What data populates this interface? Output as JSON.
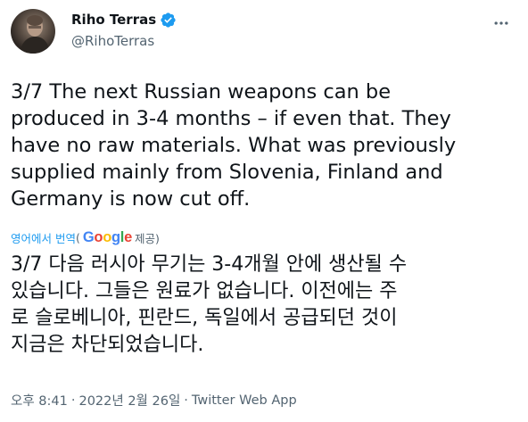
{
  "author": {
    "display_name": "Riho Terras",
    "handle": "@RihoTerras",
    "verified": true
  },
  "tweet": {
    "text": "3/7 The next Russian weapons can be\nproduced in 3-4 months – if even that. They\nhave no raw materials. What was previously\nsupplied mainly from Slovenia, Finland and\nGermany is now cut off.",
    "translate_label": "영어에서 번역",
    "translate_paren_open": "(",
    "translate_provider": "Google",
    "translate_provider_suffix": " 제공)",
    "translated_text": "3/7 다음 러시아 무기는 3-4개월 안에 생산될 수\n있습니다. 그들은 원료가 없습니다. 이전에는 주\n로 슬로베니아, 핀란드, 독일에서 공급되던 것이\n지금은 차단되었습니다.",
    "time": "오후 8:41",
    "date": "2022년 2월 26일",
    "separator": "·",
    "source": "Twitter Web App"
  },
  "colors": {
    "verified": "#1d9bf0",
    "link": "#1d9bf0",
    "muted": "#536471",
    "text": "#0f1419"
  },
  "icons": {
    "more": "more-icon",
    "verified": "verified-badge-icon"
  }
}
